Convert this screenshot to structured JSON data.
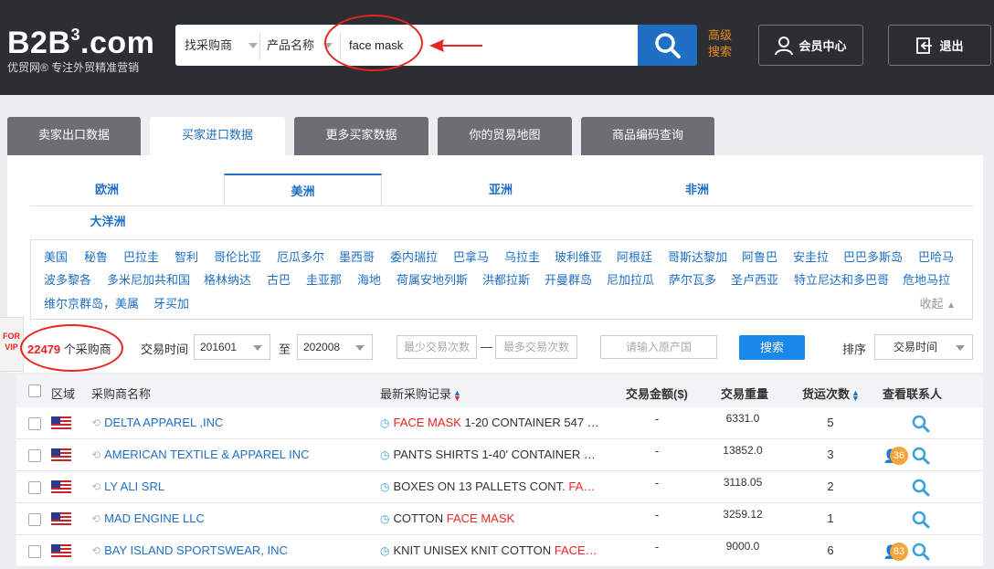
{
  "header": {
    "logo_main": "B2B",
    "logo_sup": "3",
    "logo_suffix": ".com",
    "logo_sub": "优贸网® 专注外贸精准营销",
    "search_type": "找采购商",
    "search_field": "产品名称",
    "search_value": "face mask",
    "advanced_search": "高级搜索",
    "member_center": "会员中心",
    "logout": "退出"
  },
  "main_tabs": [
    {
      "label": "卖家出口数据"
    },
    {
      "label": "买家进口数据"
    },
    {
      "label": "更多买家数据"
    },
    {
      "label": "你的贸易地图"
    },
    {
      "label": "商品编码查询"
    }
  ],
  "regions": [
    {
      "label": "欧洲"
    },
    {
      "label": "美洲"
    },
    {
      "label": "亚洲"
    },
    {
      "label": "非洲"
    },
    {
      "label": "大洋洲"
    }
  ],
  "countries": [
    "美国",
    "秘鲁",
    "巴拉圭",
    "智利",
    "哥伦比亚",
    "厄瓜多尔",
    "墨西哥",
    "委内瑞拉",
    "巴拿马",
    "乌拉圭",
    "玻利维亚",
    "阿根廷",
    "哥斯达黎加",
    "阿鲁巴",
    "安圭拉",
    "巴巴多斯岛",
    "巴哈马",
    "波多黎各",
    "多米尼加共和国",
    "格林纳达",
    "古巴",
    "圭亚那",
    "海地",
    "荷属安地列斯",
    "洪都拉斯",
    "开曼群岛",
    "尼加拉瓜",
    "萨尔瓦多",
    "圣卢西亚",
    "特立尼达和多巴哥",
    "危地马拉",
    "维尔京群岛，美属",
    "牙买加"
  ],
  "collapse_label": "收起",
  "vip_label": "FOR VIP",
  "filter": {
    "count": "22479",
    "count_suffix": "个采购商",
    "trade_time_label": "交易时间",
    "from": "201601",
    "to_label": "至",
    "to": "202008",
    "min_placeholder": "最少交易次数",
    "dash": "—",
    "max_placeholder": "最多交易次数",
    "origin_placeholder": "请输入原产国",
    "search_button": "搜索",
    "sort_label": "排序",
    "sort_value": "交易时间"
  },
  "table": {
    "headers": {
      "region": "区域",
      "buyer": "采购商名称",
      "latest": "最新采购记录",
      "amount": "交易金额($)",
      "weight": "交易重量",
      "shipments": "货运次数",
      "contact": "查看联系人"
    },
    "rows": [
      {
        "buyer": "DELTA APPAREL ,INC",
        "rec_pre": "",
        "rec_hl": "FACE MASK",
        "rec_post": " 1-20 CONTAINER 547 …",
        "amount": "-",
        "weight": "6331.0",
        "count": "5",
        "badge": ""
      },
      {
        "buyer": "AMERICAN TEXTILE & APPAREL INC",
        "rec_pre": "PANTS SHIRTS 1-40' CONTAINER …",
        "rec_hl": "",
        "rec_post": "",
        "amount": "-",
        "weight": "13852.0",
        "count": "3",
        "badge": "36"
      },
      {
        "buyer": "LY ALI SRL",
        "rec_pre": "BOXES ON 13 PALLETS CONT. ",
        "rec_hl": "FA…",
        "rec_post": "",
        "amount": "-",
        "weight": "3118.05",
        "count": "2",
        "badge": ""
      },
      {
        "buyer": "MAD ENGINE LLC",
        "rec_pre": "COTTON ",
        "rec_hl": "FACE MASK",
        "rec_post": "",
        "amount": "-",
        "weight": "3259.12",
        "count": "1",
        "badge": ""
      },
      {
        "buyer": "BAY ISLAND SPORTSWEAR, INC",
        "rec_pre": "KNIT UNISEX KNIT COTTON ",
        "rec_hl": "FACE…",
        "rec_post": "",
        "amount": "-",
        "weight": "9000.0",
        "count": "6",
        "badge": "83"
      }
    ]
  }
}
